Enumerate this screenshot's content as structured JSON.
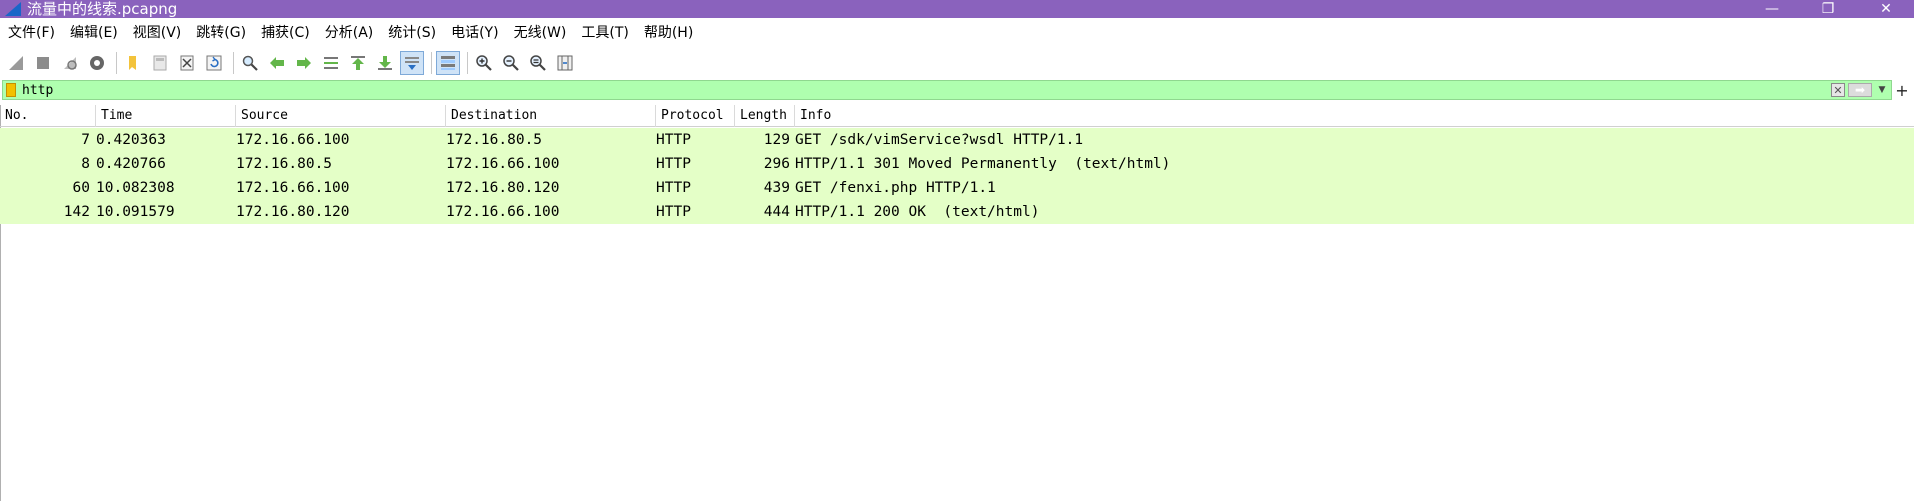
{
  "window": {
    "title": "流量中的线索.pcapng",
    "minimize": "—",
    "restore": "❐",
    "close": "✕"
  },
  "menu": [
    "文件(F)",
    "编辑(E)",
    "视图(V)",
    "跳转(G)",
    "捕获(C)",
    "分析(A)",
    "统计(S)",
    "电话(Y)",
    "无线(W)",
    "工具(T)",
    "帮助(H)"
  ],
  "toolbar": {
    "icons": [
      "shark-fin-icon",
      "stop-icon",
      "restart-icon",
      "capture-options-icon",
      "open-file-icon",
      "save-file-icon",
      "close-file-icon",
      "reload-icon",
      "find-packet-icon",
      "go-back-icon",
      "go-forward-icon",
      "go-to-packet-icon",
      "first-packet-icon",
      "last-packet-icon",
      "autoscroll-icon",
      "colorize-icon",
      "zoom-in-icon",
      "zoom-out-icon",
      "normal-size-icon",
      "resize-columns-icon"
    ]
  },
  "filter": {
    "value": "http"
  },
  "columns": [
    "No.",
    "Time",
    "Source",
    "Destination",
    "Protocol",
    "Length",
    "Info"
  ],
  "packets": [
    {
      "no": "7",
      "time": "0.420363",
      "source": "172.16.66.100",
      "destination": "172.16.80.5",
      "protocol": "HTTP",
      "length": "129",
      "info": "GET /sdk/vimService?wsdl HTTP/1.1"
    },
    {
      "no": "8",
      "time": "0.420766",
      "source": "172.16.80.5",
      "destination": "172.16.66.100",
      "protocol": "HTTP",
      "length": "296",
      "info": "HTTP/1.1 301 Moved Permanently  (text/html)"
    },
    {
      "no": "60",
      "time": "10.082308",
      "source": "172.16.66.100",
      "destination": "172.16.80.120",
      "protocol": "HTTP",
      "length": "439",
      "info": "GET /fenxi.php HTTP/1.1"
    },
    {
      "no": "142",
      "time": "10.091579",
      "source": "172.16.80.120",
      "destination": "172.16.66.100",
      "protocol": "HTTP",
      "length": "444",
      "info": "HTTP/1.1 200 OK  (text/html)"
    }
  ],
  "colors": {
    "titlebar": "#8a62bd",
    "filter_ok": "#afffaf",
    "http_row": "#e4ffc7"
  }
}
